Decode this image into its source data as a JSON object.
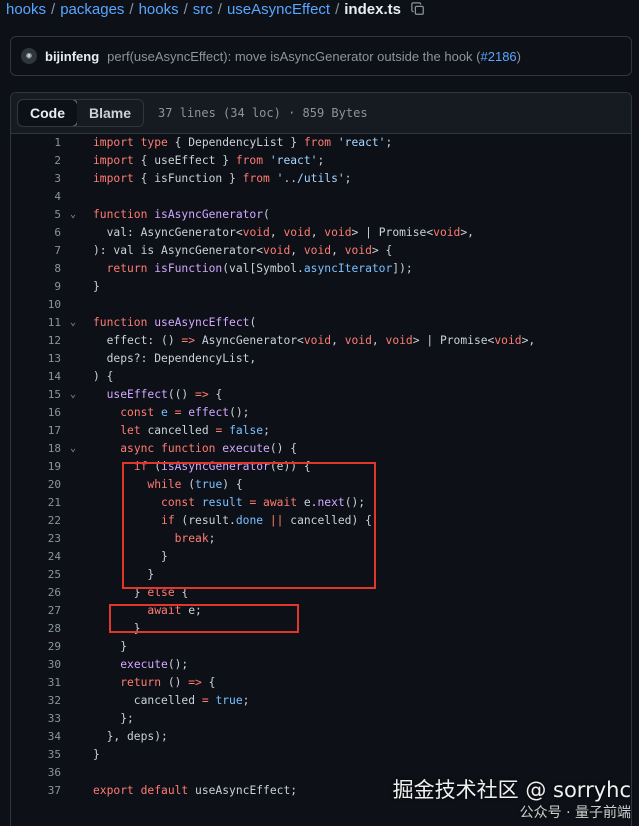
{
  "breadcrumb": {
    "parts": [
      "hooks",
      "packages",
      "hooks",
      "src",
      "useAsyncEffect"
    ],
    "file": "index.ts"
  },
  "commit": {
    "author": "bijinfeng",
    "message": "perf(useAsyncEffect): move isAsyncGenerator outside the hook (",
    "pr": "#2186",
    "message_end": ")"
  },
  "file_header": {
    "tab_code": "Code",
    "tab_blame": "Blame",
    "meta": "37 lines (34 loc) · 859 Bytes"
  },
  "code": {
    "lines": [
      {
        "n": "1",
        "fold": false,
        "t": [
          [
            "kw",
            "import type "
          ],
          [
            "pl",
            "{ DependencyList } "
          ],
          [
            "kw",
            "from "
          ],
          [
            "str",
            "'react'"
          ],
          [
            "pl",
            ";"
          ]
        ]
      },
      {
        "n": "2",
        "fold": false,
        "t": [
          [
            "kw",
            "import "
          ],
          [
            "pl",
            "{ useEffect } "
          ],
          [
            "kw",
            "from "
          ],
          [
            "str",
            "'react'"
          ],
          [
            "pl",
            ";"
          ]
        ]
      },
      {
        "n": "3",
        "fold": false,
        "t": [
          [
            "kw",
            "import "
          ],
          [
            "pl",
            "{ isFunction } "
          ],
          [
            "kw",
            "from "
          ],
          [
            "str",
            "'../utils'"
          ],
          [
            "pl",
            ";"
          ]
        ]
      },
      {
        "n": "4",
        "fold": false,
        "t": []
      },
      {
        "n": "5",
        "fold": true,
        "t": [
          [
            "kw",
            "function "
          ],
          [
            "fn",
            "isAsyncGenerator"
          ],
          [
            "pl",
            "("
          ]
        ]
      },
      {
        "n": "6",
        "fold": false,
        "t": [
          [
            "pl",
            "  val: AsyncGenerator<"
          ],
          [
            "kw",
            "void"
          ],
          [
            "pl",
            ", "
          ],
          [
            "kw",
            "void"
          ],
          [
            "pl",
            ", "
          ],
          [
            "kw",
            "void"
          ],
          [
            "pl",
            "> | Promise<"
          ],
          [
            "kw",
            "void"
          ],
          [
            "pl",
            ">,"
          ]
        ]
      },
      {
        "n": "7",
        "fold": false,
        "t": [
          [
            "pl",
            "): val is AsyncGenerator<"
          ],
          [
            "kw",
            "void"
          ],
          [
            "pl",
            ", "
          ],
          [
            "kw",
            "void"
          ],
          [
            "pl",
            ", "
          ],
          [
            "kw",
            "void"
          ],
          [
            "pl",
            "> {"
          ]
        ]
      },
      {
        "n": "8",
        "fold": false,
        "t": [
          [
            "pl",
            "  "
          ],
          [
            "kw",
            "return "
          ],
          [
            "fn",
            "isFunction"
          ],
          [
            "pl",
            "(val[Symbol."
          ],
          [
            "cst",
            "asyncIterator"
          ],
          [
            "pl",
            "]);"
          ]
        ]
      },
      {
        "n": "9",
        "fold": false,
        "t": [
          [
            "pl",
            "}"
          ]
        ]
      },
      {
        "n": "10",
        "fold": false,
        "t": []
      },
      {
        "n": "11",
        "fold": true,
        "t": [
          [
            "kw",
            "function "
          ],
          [
            "fn",
            "useAsyncEffect"
          ],
          [
            "pl",
            "("
          ]
        ]
      },
      {
        "n": "12",
        "fold": false,
        "t": [
          [
            "pl",
            "  effect: () "
          ],
          [
            "kw",
            "=> "
          ],
          [
            "pl",
            "AsyncGenerator<"
          ],
          [
            "kw",
            "void"
          ],
          [
            "pl",
            ", "
          ],
          [
            "kw",
            "void"
          ],
          [
            "pl",
            ", "
          ],
          [
            "kw",
            "void"
          ],
          [
            "pl",
            "> | Promise<"
          ],
          [
            "kw",
            "void"
          ],
          [
            "pl",
            ">,"
          ]
        ]
      },
      {
        "n": "13",
        "fold": false,
        "t": [
          [
            "pl",
            "  deps?: DependencyList,"
          ]
        ]
      },
      {
        "n": "14",
        "fold": false,
        "t": [
          [
            "pl",
            ") {"
          ]
        ]
      },
      {
        "n": "15",
        "fold": true,
        "t": [
          [
            "pl",
            "  "
          ],
          [
            "fn",
            "useEffect"
          ],
          [
            "pl",
            "(() "
          ],
          [
            "kw",
            "=> "
          ],
          [
            "pl",
            "{"
          ]
        ]
      },
      {
        "n": "16",
        "fold": false,
        "t": [
          [
            "pl",
            "    "
          ],
          [
            "kw",
            "const "
          ],
          [
            "cst",
            "e "
          ],
          [
            "kw",
            "= "
          ],
          [
            "fn",
            "effect"
          ],
          [
            "pl",
            "();"
          ]
        ]
      },
      {
        "n": "17",
        "fold": false,
        "t": [
          [
            "pl",
            "    "
          ],
          [
            "kw",
            "let "
          ],
          [
            "pl",
            "cancelled "
          ],
          [
            "kw",
            "= "
          ],
          [
            "cst",
            "false"
          ],
          [
            "pl",
            ";"
          ]
        ]
      },
      {
        "n": "18",
        "fold": true,
        "t": [
          [
            "pl",
            "    "
          ],
          [
            "kw",
            "async function "
          ],
          [
            "fn",
            "execute"
          ],
          [
            "pl",
            "() {"
          ]
        ]
      },
      {
        "n": "19",
        "fold": false,
        "t": [
          [
            "pl",
            "      "
          ],
          [
            "kw",
            "if "
          ],
          [
            "pl",
            "("
          ],
          [
            "fn",
            "isAsyncGenerator"
          ],
          [
            "pl",
            "(e)) {"
          ]
        ]
      },
      {
        "n": "20",
        "fold": false,
        "t": [
          [
            "pl",
            "        "
          ],
          [
            "kw",
            "while "
          ],
          [
            "pl",
            "("
          ],
          [
            "cst",
            "true"
          ],
          [
            "pl",
            ") {"
          ]
        ]
      },
      {
        "n": "21",
        "fold": false,
        "t": [
          [
            "pl",
            "          "
          ],
          [
            "kw",
            "const "
          ],
          [
            "cst",
            "result "
          ],
          [
            "kw",
            "= await "
          ],
          [
            "pl",
            "e."
          ],
          [
            "fn",
            "next"
          ],
          [
            "pl",
            "();"
          ]
        ]
      },
      {
        "n": "22",
        "fold": false,
        "t": [
          [
            "pl",
            "          "
          ],
          [
            "kw",
            "if "
          ],
          [
            "pl",
            "(result."
          ],
          [
            "cst",
            "done "
          ],
          [
            "kw",
            "|| "
          ],
          [
            "pl",
            "cancelled) {"
          ]
        ]
      },
      {
        "n": "23",
        "fold": false,
        "t": [
          [
            "pl",
            "            "
          ],
          [
            "kw",
            "break"
          ],
          [
            "pl",
            ";"
          ]
        ]
      },
      {
        "n": "24",
        "fold": false,
        "t": [
          [
            "pl",
            "          }"
          ]
        ]
      },
      {
        "n": "25",
        "fold": false,
        "t": [
          [
            "pl",
            "        }"
          ]
        ]
      },
      {
        "n": "26",
        "fold": false,
        "t": [
          [
            "pl",
            "      } "
          ],
          [
            "kw",
            "else "
          ],
          [
            "pl",
            "{"
          ]
        ]
      },
      {
        "n": "27",
        "fold": false,
        "t": [
          [
            "pl",
            "        "
          ],
          [
            "kw",
            "await "
          ],
          [
            "pl",
            "e;"
          ]
        ]
      },
      {
        "n": "28",
        "fold": false,
        "t": [
          [
            "pl",
            "      }"
          ]
        ]
      },
      {
        "n": "29",
        "fold": false,
        "t": [
          [
            "pl",
            "    }"
          ]
        ]
      },
      {
        "n": "30",
        "fold": false,
        "t": [
          [
            "pl",
            "    "
          ],
          [
            "fn",
            "execute"
          ],
          [
            "pl",
            "();"
          ]
        ]
      },
      {
        "n": "31",
        "fold": false,
        "t": [
          [
            "pl",
            "    "
          ],
          [
            "kw",
            "return "
          ],
          [
            "pl",
            "() "
          ],
          [
            "kw",
            "=> "
          ],
          [
            "pl",
            "{"
          ]
        ]
      },
      {
        "n": "32",
        "fold": false,
        "t": [
          [
            "pl",
            "      cancelled "
          ],
          [
            "kw",
            "= "
          ],
          [
            "cst",
            "true"
          ],
          [
            "pl",
            ";"
          ]
        ]
      },
      {
        "n": "33",
        "fold": false,
        "t": [
          [
            "pl",
            "    };"
          ]
        ]
      },
      {
        "n": "34",
        "fold": false,
        "t": [
          [
            "pl",
            "  }, deps);"
          ]
        ]
      },
      {
        "n": "35",
        "fold": false,
        "t": [
          [
            "pl",
            "}"
          ]
        ]
      },
      {
        "n": "36",
        "fold": false,
        "t": []
      },
      {
        "n": "37",
        "fold": false,
        "t": [
          [
            "kw",
            "export default "
          ],
          [
            "pl",
            "useAsyncEffect;"
          ]
        ]
      }
    ]
  },
  "watermark": {
    "main": "掘金技术社区 @ sorryhc",
    "sub": "公众号 · 量子前端"
  },
  "colors": {
    "background": "#0d1117",
    "link": "#58a6ff",
    "keyword": "#ff7b72",
    "function": "#d2a8ff",
    "string": "#a5d6ff",
    "constant": "#79c0ff",
    "highlight_box": "#e0362c"
  },
  "icons": [
    "copy-icon",
    "avatar",
    "chevron-down-icon"
  ]
}
